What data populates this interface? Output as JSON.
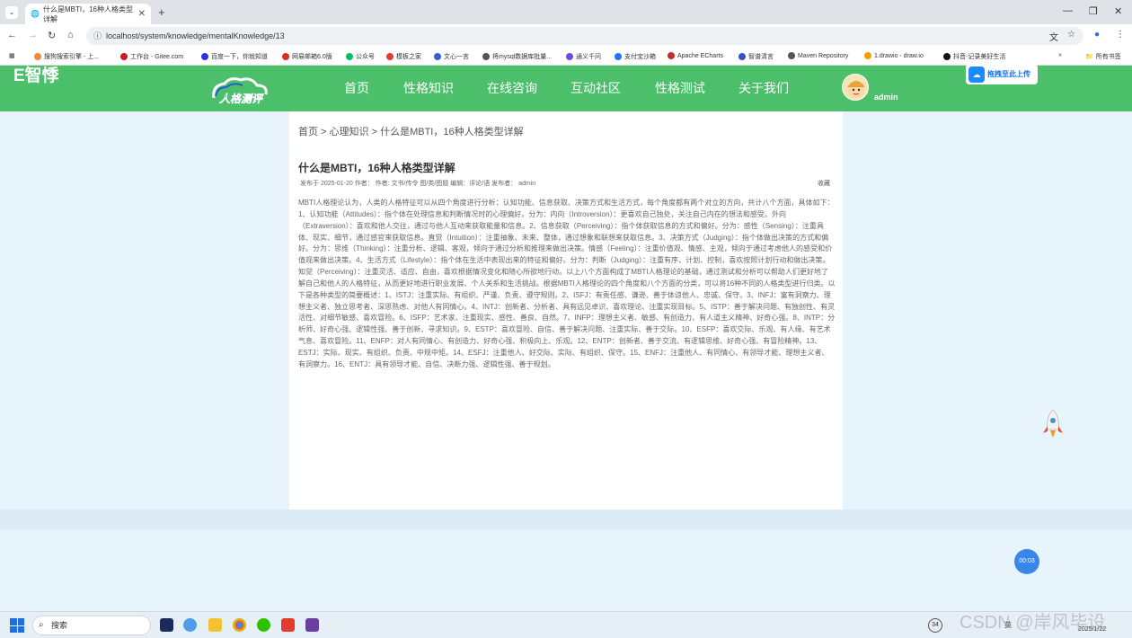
{
  "browser": {
    "tab_title": "什么是MBTI，16种人格类型详解",
    "url": "localhost/system/knowledge/mentalKnowledge/13",
    "bookmarks": [
      "搜狗搜索引擎 - 上...",
      "工作台 - Gitee.com",
      "百度一下，你就知道",
      "网易邮箱6.0版",
      "公众号",
      "模板之家",
      "文心一言",
      "将mysql数据库批量...",
      "通义千问",
      "支付宝沙箱",
      "Apache ECharts",
      "智谱清言",
      "Maven Repository",
      "1.drawio - draw.io",
      "抖音-记录美好生活"
    ],
    "all_bookmarks": "所有书签"
  },
  "header": {
    "brand": "E智悸",
    "logo_text": "人格测评",
    "nav": [
      "首页",
      "性格知识",
      "在线咨询",
      "互动社区",
      "性格测试",
      "关于我们"
    ],
    "username": "admin",
    "upload_label": "拖拽至此上传"
  },
  "article": {
    "breadcrumb": "首页 > 心理知识 > 什么是MBTI，16种人格类型详解",
    "title": "什么是MBTI，16种人格类型详解",
    "meta": "发布于 2025-01-20 作者：   作者: 文书/传令 图/类/图题 编辑：评论/语 发布者：   admin",
    "favorite": "收藏",
    "body": "MBTI人格理论认为，人类的人格特征可以从四个角度进行分析：认知功能、信息获取、决策方式和生活方式，每个角度都有两个对立的方向，共计八个方面，具体如下：1、认知功能（Attitudes）：指个体在处理信息和判断情况时的心理偏好。分为：内向（Introversion）：更喜欢自己独处，关注自己内在的想法和感受。外向（Extraversion）：喜欢和他人交往，通过与他人互动来获取能量和信息。2、信息获取（Perceiving）：指个体获取信息的方式和偏好。分为：感性（Sensing）：注重具体、现实、细节，通过感官来获取信息。直觉（Intuition）：注重抽象、未来、整体，通过想象和联想来获取信息。3、决策方式（Judging）：指个体做出决策的方式和偏好。分为：思维（Thinking）：注重分析、逻辑、客观，倾向于通过分析和推理来做出决策。情感（Feeling）：注重价值观、情感、主观，倾向于通过考虑他人的感受和价值观来做出决策。4、生活方式（Lifestyle）：指个体在生活中表现出来的特征和偏好。分为：判断（Judging）：注重有序、计划、控制，喜欢按照计划行动和做出决策。知觉（Perceiving）：注重灵活、适应、自由，喜欢根据情况变化和随心所欲地行动。以上八个方面构成了MBTI人格理论的基础，通过测试和分析可以帮助人们更好地了解自己和他人的人格特征，从而更好地进行职业发展、个人关系和生活挑战。根据MBTI人格理论的四个角度和八个方面的分类，可以将16种不同的人格类型进行归类。以下是各种类型的简要概述：1、ISTJ：注重实际、有组织、严谨、负责、遵守规则。2、ISFJ：有责任感、谦逊、善于体谅他人、忠诚、保守。3、INFJ：富有洞察力、理想主义者、独立思考者、深思熟虑、对他人有同情心。4、INTJ：创新者、分析者、具有远见卓识、喜欢理论、注重实现目标。5、ISTP：善于解决问题、有独创性、有灵活性、对细节敏感、喜欢冒险。6、ISFP：艺术家、注重现实、感性、善良、自然。7、INFP：理想主义者、敏感、有创造力、有人道主义精神、好奇心强。8、INTP：分析师、好奇心强、逻辑性强、善于创新、寻求知识。9、ESTP：喜欢冒险、自信、善于解决问题、注重实际、善于交际。10、ESFP：喜欢交际、乐观、有人缘、有艺术气息、喜欢冒险。11、ENFP：对人有同情心、有创造力、好奇心强、积极向上、乐观。12、ENTP：创新者、善于交流、有逻辑思维、好奇心强、有冒险精神。13、ESTJ：实际、现实、有组织、负责、中规中矩。14、ESFJ：注重他人、好交际、实际、有组织、保守。15、ENFJ：注重他人、有同情心、有领导才能、理想主义者、有洞察力。16、ENTJ：具有领导才能、自信、决断力强、逻辑性强、善于规划。"
  },
  "timer_label": "00:03",
  "taskbar": {
    "search_label": "搜索",
    "badge": "34",
    "ime": "英",
    "date": "2025/1/22"
  },
  "watermark": "CSDN @岸风毕设"
}
